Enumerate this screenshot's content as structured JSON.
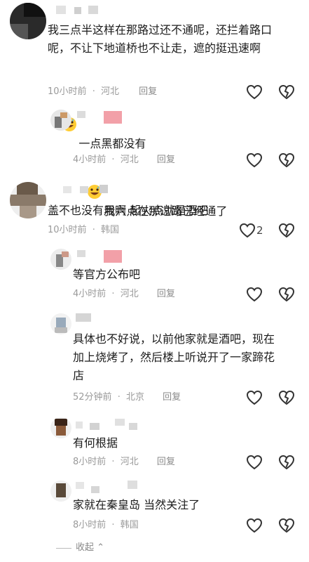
{
  "comments": [
    {
      "text": "我三点半这样在那路过还不通呢，还拦着路口\n呢，不让下地道桥也不让走，遮的挺迅速啊",
      "text2": "一点黑都没有",
      "time": "10小时前",
      "location": "河北",
      "reply": "回复",
      "replies": [
        {
          "text": "我六点在那过路已经通了",
          "time": "4小时前",
          "location": "河北",
          "reply": "回复"
        }
      ]
    },
    {
      "text": "盖不也没有用啊 起火点就是酒吧",
      "time": "10小时前",
      "location": "韩国",
      "reply": "回复",
      "likes": "2",
      "replies": [
        {
          "text": "等官方公布吧",
          "time": "4小时前",
          "location": "河北",
          "reply": "回复"
        },
        {
          "text": "具体也不好说，以前他家就是酒吧，现在\n加上烧烤了，然后楼上听说开了一家蹄花\n店",
          "time": "52分钟前",
          "location": "北京",
          "reply": "回复"
        },
        {
          "text": "有何根据",
          "time": "8小时前",
          "location": "河北",
          "reply": "回复"
        },
        {
          "text": "家就在秦皇岛 当然关注了",
          "time": "8小时前",
          "location": "韩国",
          "reply": "回复"
        }
      ]
    }
  ],
  "collapse_label": "收起",
  "separator": "·",
  "colors": {
    "meta": "#9a9a9a",
    "text": "#1c1c1c",
    "accent_pink": "#f2a0a8"
  }
}
